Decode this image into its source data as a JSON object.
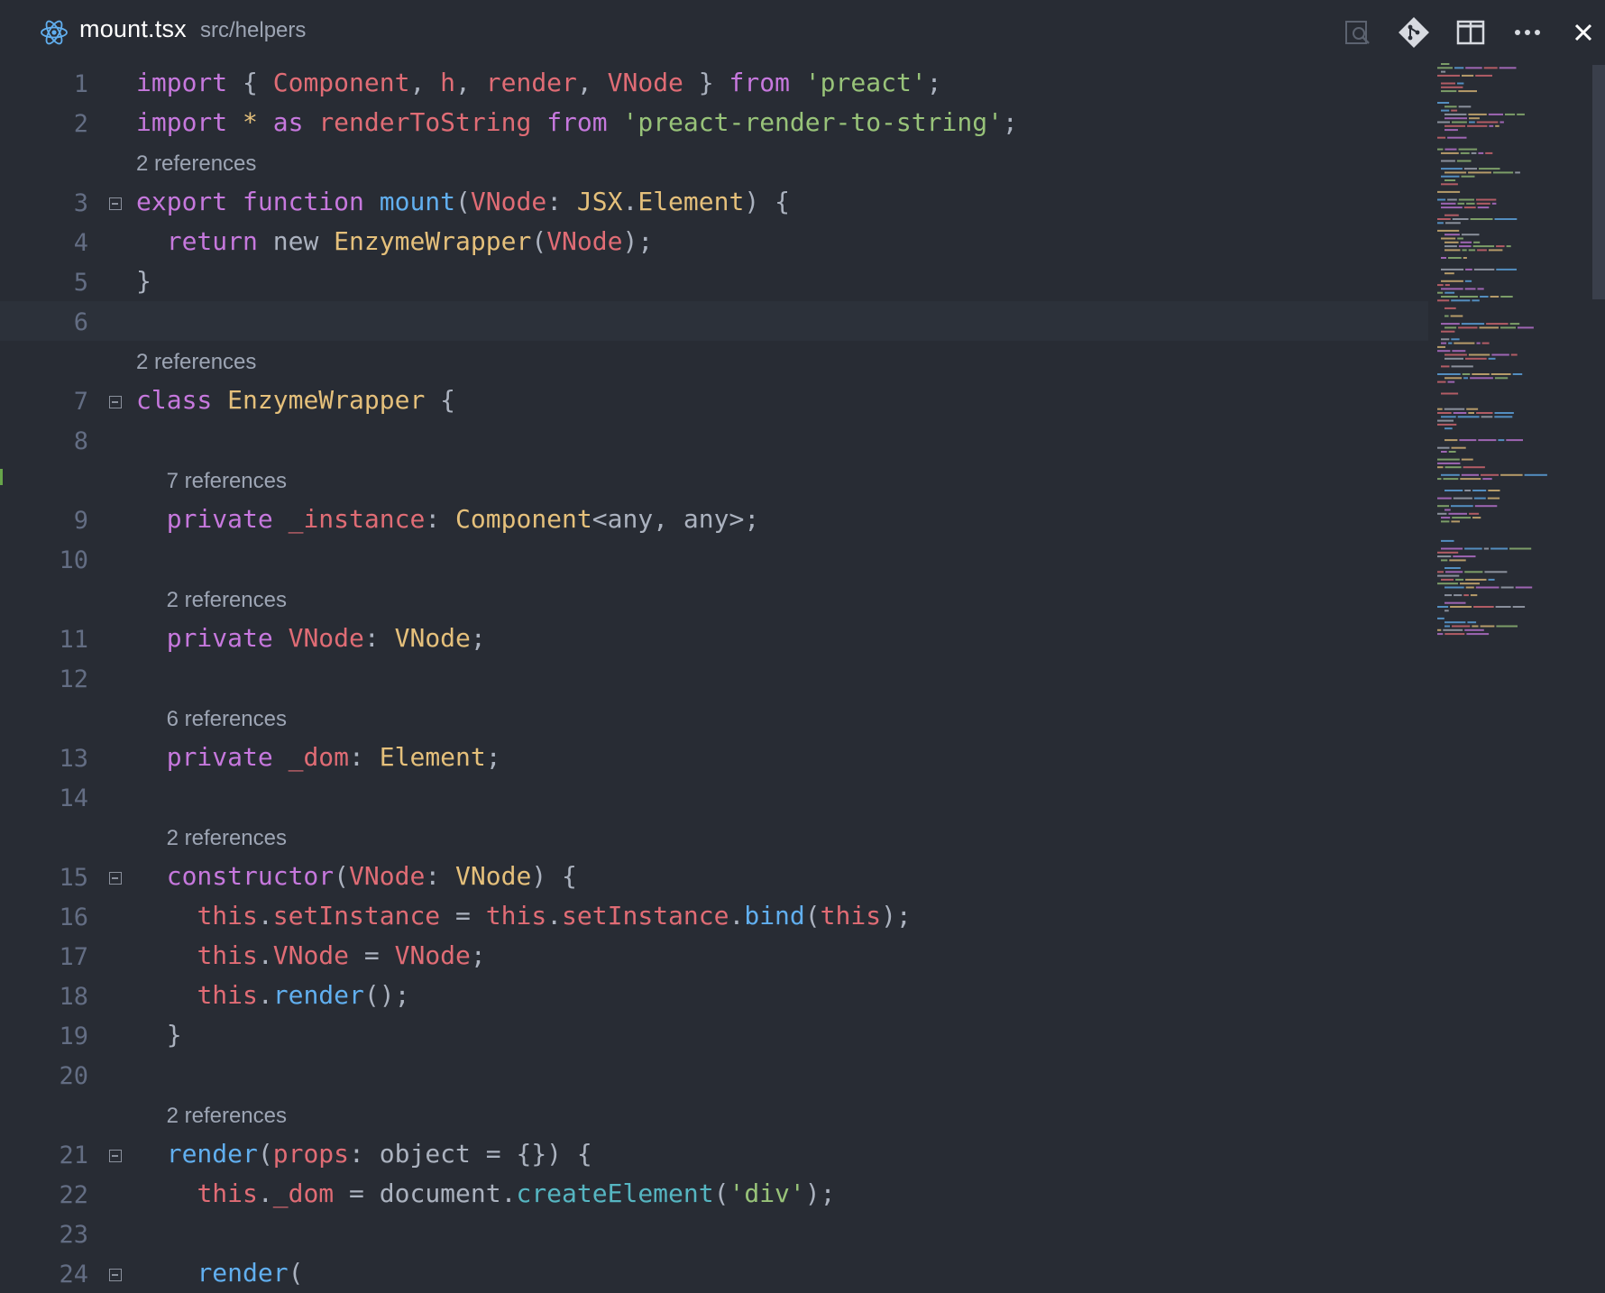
{
  "tab": {
    "file_name": "mount.tsx",
    "path": "src/helpers",
    "icon": "react-icon"
  },
  "toolbar": {
    "icons": [
      "find-references-icon",
      "git-icon",
      "split-editor-icon",
      "more-icon",
      "close-icon"
    ]
  },
  "colors": {
    "background": "#282c34",
    "keyword": "#c678dd",
    "variable": "#e06c75",
    "string": "#98c379",
    "type": "#e5c07b",
    "function": "#61afef",
    "operator": "#56b6c2",
    "line_number": "#636d83"
  },
  "editor": {
    "lines": [
      {
        "n": "1",
        "tokens": [
          [
            "kw",
            "import"
          ],
          [
            "p",
            " { "
          ],
          [
            "var",
            "Component"
          ],
          [
            "p",
            ", "
          ],
          [
            "var",
            "h"
          ],
          [
            "p",
            ", "
          ],
          [
            "var",
            "render"
          ],
          [
            "p",
            ", "
          ],
          [
            "var",
            "VNode"
          ],
          [
            "p",
            " } "
          ],
          [
            "kw",
            "from"
          ],
          [
            "p",
            " "
          ],
          [
            "str",
            "'preact'"
          ],
          [
            "p",
            ";"
          ]
        ]
      },
      {
        "n": "2",
        "tokens": [
          [
            "kw",
            "import"
          ],
          [
            "p",
            " "
          ],
          [
            "type",
            "*"
          ],
          [
            "p",
            " "
          ],
          [
            "kw",
            "as"
          ],
          [
            "p",
            " "
          ],
          [
            "var",
            "renderToString"
          ],
          [
            "p",
            " "
          ],
          [
            "kw",
            "from"
          ],
          [
            "p",
            " "
          ],
          [
            "str",
            "'preact-render-to-string'"
          ],
          [
            "p",
            ";"
          ]
        ]
      },
      {
        "n": "3",
        "tokens": [
          [
            "kw",
            "export"
          ],
          [
            "p",
            " "
          ],
          [
            "kw",
            "function"
          ],
          [
            "p",
            " "
          ],
          [
            "fn",
            "mount"
          ],
          [
            "p",
            "("
          ],
          [
            "var",
            "VNode"
          ],
          [
            "p",
            ": "
          ],
          [
            "type",
            "JSX"
          ],
          [
            "p",
            "."
          ],
          [
            "type",
            "Element"
          ],
          [
            "p",
            ") {"
          ]
        ]
      },
      {
        "n": "4",
        "tokens": [
          [
            "p",
            "  "
          ],
          [
            "kw",
            "return"
          ],
          [
            "p",
            " new "
          ],
          [
            "type",
            "EnzymeWrapper"
          ],
          [
            "p",
            "("
          ],
          [
            "var",
            "VNode"
          ],
          [
            "p",
            ");"
          ]
        ]
      },
      {
        "n": "5",
        "tokens": [
          [
            "p",
            "}"
          ]
        ]
      },
      {
        "n": "6",
        "tokens": []
      },
      {
        "n": "7",
        "tokens": [
          [
            "kw",
            "class"
          ],
          [
            "p",
            " "
          ],
          [
            "type",
            "EnzymeWrapper"
          ],
          [
            "p",
            " {"
          ]
        ]
      },
      {
        "n": "8",
        "tokens": []
      },
      {
        "n": "9",
        "tokens": [
          [
            "p",
            "  "
          ],
          [
            "kw",
            "private"
          ],
          [
            "p",
            " "
          ],
          [
            "var",
            "_instance"
          ],
          [
            "p",
            ": "
          ],
          [
            "type",
            "Component"
          ],
          [
            "p",
            "<any, any>;"
          ]
        ]
      },
      {
        "n": "10",
        "tokens": []
      },
      {
        "n": "11",
        "tokens": [
          [
            "p",
            "  "
          ],
          [
            "kw",
            "private"
          ],
          [
            "p",
            " "
          ],
          [
            "var",
            "VNode"
          ],
          [
            "p",
            ": "
          ],
          [
            "type",
            "VNode"
          ],
          [
            "p",
            ";"
          ]
        ]
      },
      {
        "n": "12",
        "tokens": []
      },
      {
        "n": "13",
        "tokens": [
          [
            "p",
            "  "
          ],
          [
            "kw",
            "private"
          ],
          [
            "p",
            " "
          ],
          [
            "var",
            "_dom"
          ],
          [
            "p",
            ": "
          ],
          [
            "type",
            "Element"
          ],
          [
            "p",
            ";"
          ]
        ]
      },
      {
        "n": "14",
        "tokens": []
      },
      {
        "n": "15",
        "tokens": [
          [
            "p",
            "  "
          ],
          [
            "kw",
            "constructor"
          ],
          [
            "p",
            "("
          ],
          [
            "var",
            "VNode"
          ],
          [
            "p",
            ": "
          ],
          [
            "type",
            "VNode"
          ],
          [
            "p",
            ") {"
          ]
        ]
      },
      {
        "n": "16",
        "tokens": [
          [
            "p",
            "    "
          ],
          [
            "var",
            "this"
          ],
          [
            "p",
            "."
          ],
          [
            "var",
            "setInstance"
          ],
          [
            "p",
            " = "
          ],
          [
            "var",
            "this"
          ],
          [
            "p",
            "."
          ],
          [
            "var",
            "setInstance"
          ],
          [
            "p",
            "."
          ],
          [
            "fn",
            "bind"
          ],
          [
            "p",
            "("
          ],
          [
            "var",
            "this"
          ],
          [
            "p",
            ");"
          ]
        ]
      },
      {
        "n": "17",
        "tokens": [
          [
            "p",
            "    "
          ],
          [
            "var",
            "this"
          ],
          [
            "p",
            "."
          ],
          [
            "var",
            "VNode"
          ],
          [
            "p",
            " = "
          ],
          [
            "var",
            "VNode"
          ],
          [
            "p",
            ";"
          ]
        ]
      },
      {
        "n": "18",
        "tokens": [
          [
            "p",
            "    "
          ],
          [
            "var",
            "this"
          ],
          [
            "p",
            "."
          ],
          [
            "fn",
            "render"
          ],
          [
            "p",
            "();"
          ]
        ]
      },
      {
        "n": "19",
        "tokens": [
          [
            "p",
            "  }"
          ]
        ]
      },
      {
        "n": "20",
        "tokens": []
      },
      {
        "n": "21",
        "tokens": [
          [
            "p",
            "  "
          ],
          [
            "fn",
            "render"
          ],
          [
            "p",
            "("
          ],
          [
            "var",
            "props"
          ],
          [
            "p",
            ": object = {}) {"
          ]
        ]
      },
      {
        "n": "22",
        "tokens": [
          [
            "p",
            "    "
          ],
          [
            "var",
            "this"
          ],
          [
            "p",
            "."
          ],
          [
            "var",
            "_dom"
          ],
          [
            "p",
            " = document."
          ],
          [
            "cyan",
            "createElement"
          ],
          [
            "p",
            "("
          ],
          [
            "str",
            "'div'"
          ],
          [
            "p",
            ");"
          ]
        ]
      },
      {
        "n": "23",
        "tokens": []
      },
      {
        "n": "24",
        "tokens": [
          [
            "p",
            "    "
          ],
          [
            "fn",
            "render"
          ],
          [
            "p",
            "("
          ]
        ]
      }
    ],
    "code_lens": [
      {
        "before": "3",
        "text": "2 references"
      },
      {
        "before": "7",
        "text": "2 references"
      },
      {
        "before": "9",
        "text": "7 references"
      },
      {
        "before": "11",
        "text": "2 references"
      },
      {
        "before": "13",
        "text": "6 references"
      },
      {
        "before": "15",
        "text": "2 references"
      },
      {
        "before": "21",
        "text": "2 references"
      }
    ],
    "folds": [
      "3",
      "7",
      "15",
      "21",
      "24"
    ],
    "current_line": "6"
  }
}
